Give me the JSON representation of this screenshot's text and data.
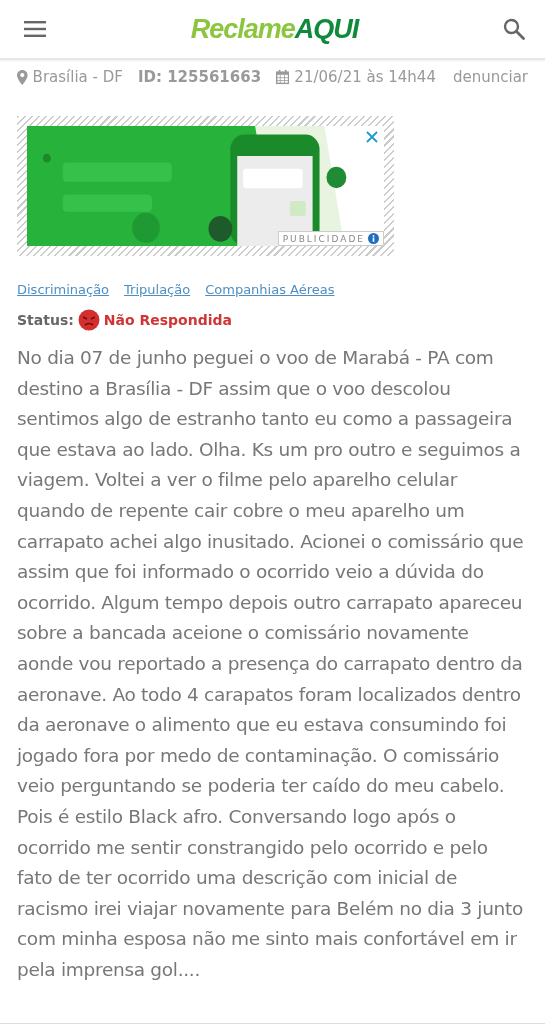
{
  "header": {
    "logo": {
      "first": "Reclame",
      "second": "AQUI"
    }
  },
  "meta": {
    "location": "Brasília - DF",
    "id": "ID: 125561663",
    "date": "21/06/21 às 14h44",
    "report_link": "denunciar"
  },
  "ad": {
    "kind": "picture",
    "label": "PUBLICIDADE"
  },
  "tags": [
    "Discriminação",
    "Tripulação",
    "Companhias Aéreas"
  ],
  "status": {
    "label": "Status:",
    "value": "Não Respondida"
  },
  "complaint": "No dia 07 de junho peguei o voo de Marabá - PA com destino a Brasília - DF assim que o voo descolou sentimos algo de estranho tanto eu como a passageira que estava ao lado. Olha. Ks um pro outro e seguimos a viagem. Voltei a ver o filme pelo aparelho celular quando de repente cair cobre o meu aparelho um carrapato achei algo inusitado. Acionei o comissário que assim que foi informado o ocorrido veio a dúvida do ocorrido. Algum tempo depois outro carrapato apareceu sobre a bancada aceione o comissário novamente aonde vou reportado a presença do carrapato dentro da aeronave. Ao todo 4 carapatos foram localizados dentro da aeronave o alimento que eu estava consumindo foi jogado fora por medo de contaminação. O comissário veio perguntando se poderia ter caído do meu cabelo. Pois é estilo Black afro. Conversando logo após o ocorrido me sentir constrangido pelo ocorrido e pelo fato de ter ocorrido uma descrição com inicial de racismo irei viajar novamente para Belém no dia 3 junto com minha esposa não me sinto mais confortável em ir pela imprensa gol...."
}
